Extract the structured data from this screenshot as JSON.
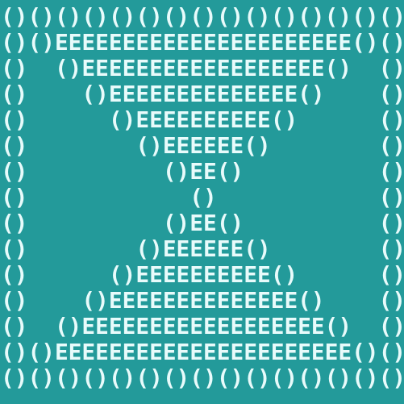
{
  "palette": {
    "background": "#239a9a",
    "glyph_color": "#e8fbfb"
  },
  "art": {
    "lines": [
      "()()()()()()()()()()()()()()()",
      "()()EEEEEEEEEEEEEEEEEEEEEE()()",
      "()  ()EEEEEEEEEEEEEEEEEE()  ()",
      "()    ()EEEEEEEEEEEEEE()    ()",
      "()      ()EEEEEEEEEE()      ()",
      "()        ()EEEEEE()        ()",
      "()          ()EE()          ()",
      "()            ()            ()",
      "()          ()EE()          ()",
      "()        ()EEEEEE()        ()",
      "()      ()EEEEEEEEEE()      ()",
      "()    ()EEEEEEEEEEEEEE()    ()",
      "()  ()EEEEEEEEEEEEEEEEEE()  ()",
      "()()EEEEEEEEEEEEEEEEEEEEEE()()",
      "()()()()()()()()()()()()()()()"
    ]
  }
}
